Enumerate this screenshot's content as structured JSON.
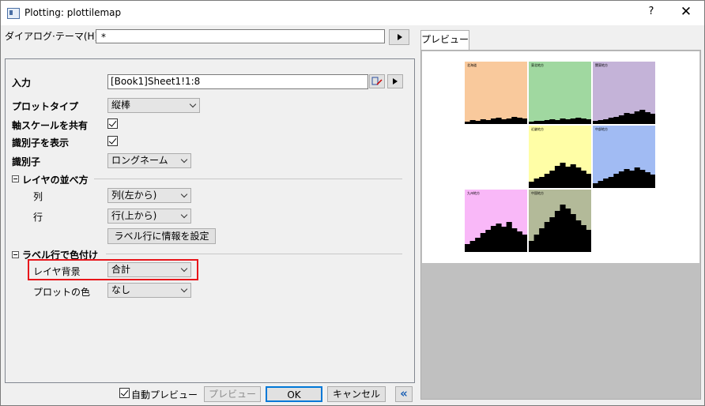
{
  "window": {
    "title": "Plotting: plottilemap",
    "help": "?",
    "close": "✕"
  },
  "theme": {
    "label": "ダイアログ·テーマ(H)",
    "value": "*"
  },
  "form": {
    "input_label": "入力",
    "input_value": "[Book1]Sheet1!1:8",
    "plot_type_label": "プロットタイプ",
    "plot_type_value": "縦棒",
    "share_axis_label": "軸スケールを共有",
    "show_identifier_label": "識別子を表示",
    "identifier_label": "識別子",
    "identifier_value": "ロングネーム",
    "layer_order_section": "レイヤの並べ方",
    "column_label": "列",
    "column_value": "列(左から)",
    "row_label": "行",
    "row_value": "行(上から)",
    "set_label_info_button": "ラベル行に情報を設定",
    "color_by_label_section": "ラベル行で色付け",
    "layer_bg_label": "レイヤ背景",
    "layer_bg_value": "合計",
    "plot_color_label": "プロットの色",
    "plot_color_value": "なし"
  },
  "bottom": {
    "auto_preview_label": "自動プレビュー",
    "preview_button": "プレビュー",
    "ok_button": "OK",
    "cancel_button": "キャンセル",
    "collapse_button": "«"
  },
  "preview": {
    "tab_label": "プレビュー",
    "tiles": [
      {
        "label": "北海道",
        "color": "#f9c99c",
        "heights": [
          3,
          5,
          4,
          6,
          5,
          7,
          8,
          6,
          7,
          9,
          8,
          7
        ]
      },
      {
        "label": "東北地方",
        "color": "#a0d8a0",
        "heights": [
          3,
          4,
          4,
          5,
          6,
          5,
          7,
          6,
          7,
          8,
          7,
          6
        ]
      },
      {
        "label": "関東地方",
        "color": "#c4b3d8",
        "heights": [
          4,
          5,
          6,
          8,
          9,
          11,
          14,
          13,
          16,
          18,
          15,
          13
        ]
      },
      {
        "label": "近畿地方",
        "color": "#fffea6",
        "heights": [
          8,
          12,
          14,
          18,
          22,
          28,
          32,
          27,
          30,
          26,
          22,
          18
        ]
      },
      {
        "label": "中部地方",
        "color": "#a1bbf3",
        "heights": [
          6,
          9,
          12,
          14,
          18,
          21,
          24,
          22,
          26,
          23,
          20,
          17
        ]
      },
      {
        "label": "九州地方",
        "color": "#f9b8f8",
        "heights": [
          10,
          14,
          18,
          24,
          28,
          33,
          36,
          32,
          38,
          30,
          26,
          22
        ]
      },
      {
        "label": "中国地方",
        "color": "#b3ba99",
        "heights": [
          14,
          22,
          30,
          38,
          44,
          52,
          60,
          55,
          48,
          40,
          34,
          28
        ]
      }
    ]
  }
}
